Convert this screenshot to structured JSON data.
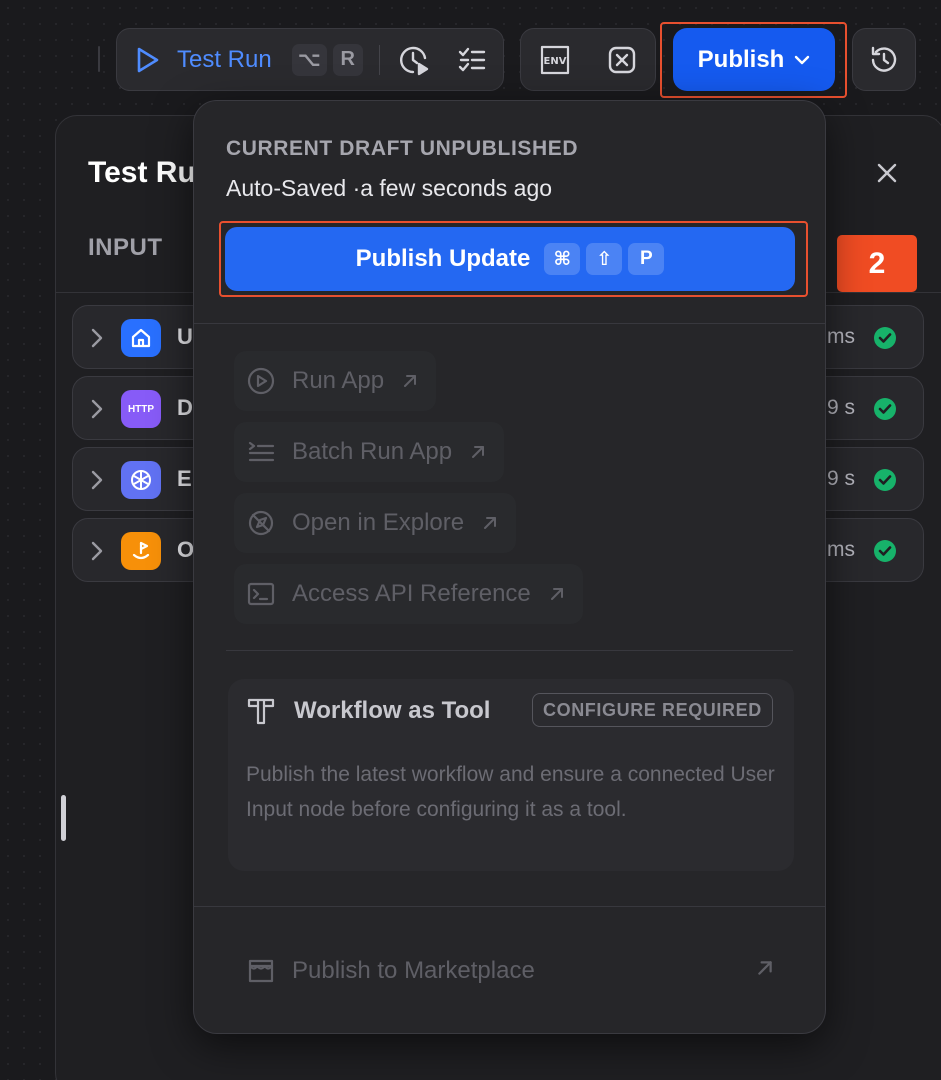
{
  "toolbar": {
    "test_run_label": "Test Run",
    "test_run_keys": [
      "⌥",
      "R"
    ],
    "publish_label": "Publish"
  },
  "test_panel": {
    "title": "Test Ru",
    "tab_input": "INPUT",
    "step_badge": "2",
    "nodes": [
      {
        "letter": "U",
        "icon": "home-icon",
        "color": "#2970ff",
        "time": "ms"
      },
      {
        "letter": "D",
        "icon": "http-icon",
        "icon_text": "HTTP",
        "color": "#875bf7",
        "time": "9 s"
      },
      {
        "letter": "E",
        "icon": "agent-icon",
        "color": "#6172f3",
        "time": "9 s"
      },
      {
        "letter": "O",
        "icon": "end-icon",
        "color": "#f79009",
        "time": "ms"
      }
    ]
  },
  "popup": {
    "status": "CURRENT DRAFT UNPUBLISHED",
    "saved": "Auto-Saved ·a few seconds ago",
    "publish_update": "Publish Update",
    "publish_update_keys": [
      "⌘",
      "⇧",
      "P"
    ],
    "items": [
      {
        "label": "Run App",
        "icon": "play-circle-icon"
      },
      {
        "label": "Batch Run App",
        "icon": "batch-list-icon"
      },
      {
        "label": "Open in Explore",
        "icon": "explore-icon"
      },
      {
        "label": "Access API Reference",
        "icon": "terminal-icon"
      }
    ],
    "tool": {
      "title": "Workflow as Tool",
      "badge": "CONFIGURE REQUIRED",
      "description": "Publish the latest workflow and ensure a connected User Input node before configuring it as a tool."
    },
    "marketplace": "Publish to Marketplace"
  },
  "colors": {
    "accent": "#155aef",
    "highlight": "#e8502f",
    "success": "#17b26a"
  }
}
